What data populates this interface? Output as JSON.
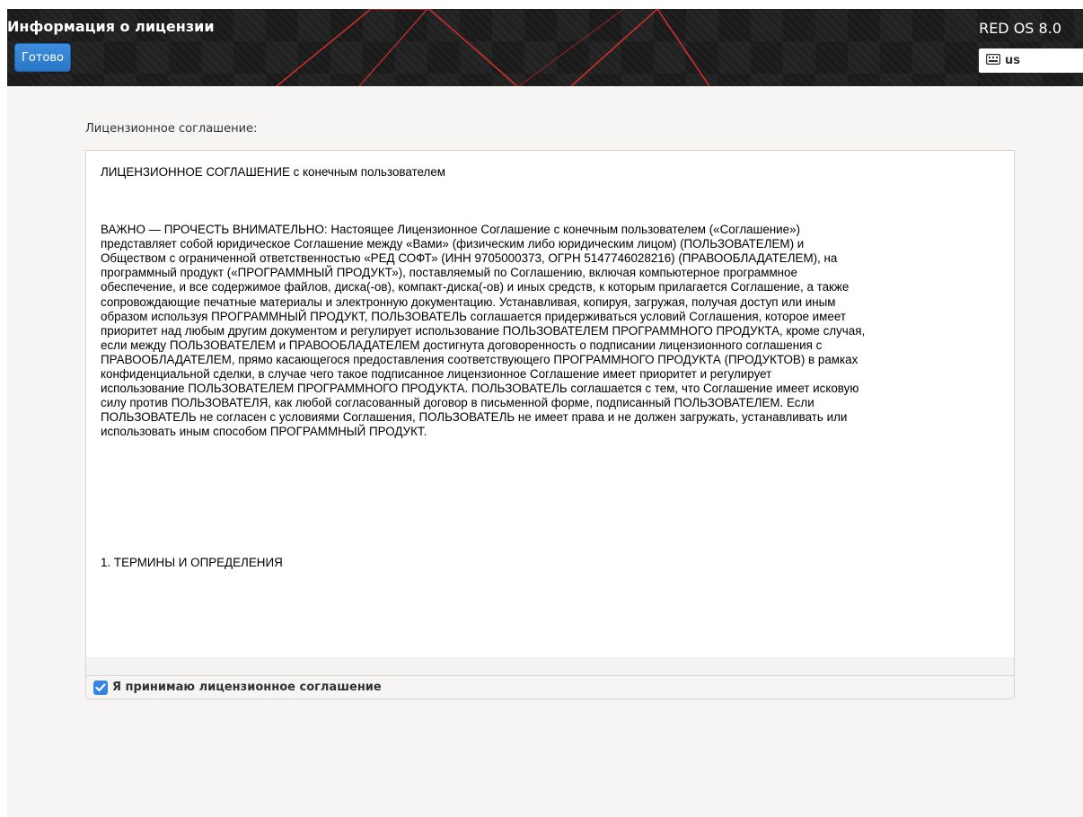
{
  "header": {
    "title": "Информация о лицензии",
    "done_label": "Готово",
    "os_name": "RED OS 8.0",
    "keyboard_layout": "us",
    "keyboard_icon": "keyboard-icon",
    "accent_color": "#3584e4"
  },
  "license": {
    "section_label": "Лицензионное соглашение:",
    "heading": "ЛИЦЕНЗИОННОЕ СОГЛАШЕНИЕ с конечным пользователем",
    "body": "ВАЖНО — ПРОЧЕСТЬ ВНИМАТЕЛЬНО: Настоящее Лицензионное Соглашение с конечным пользователем («Соглашение»)\nпредставляет собой юридическое Соглашение между «Вами» (физическим либо юридическим лицом) (ПОЛЬЗОВАТЕЛЕМ) и\nОбществом с ограниченной ответственностью «РЕД СОФТ» (ИНН 9705000373, ОГРН 5147746028216) (ПРАВООБЛАДАТЕЛЕМ), на\nпрограммный продукт («ПРОГРАММНЫЙ ПРОДУКТ»), поставляемый по Соглашению, включая компьютерное программное\nобеспечение, и все содержимое файлов, диска(-ов), компакт-диска(-ов) и иных средств, к которым прилагается Соглашение, а также\nсопровождающие печатные материалы и электронную документацию. Устанавливая, копируя, загружая, получая доступ или иным\nобразом используя ПРОГРАММНЫЙ ПРОДУКТ, ПОЛЬЗОВАТЕЛЬ соглашается придерживаться условий Соглашения, которое имеет\nприоритет над любым другим документом и регулирует использование ПОЛЬЗОВАТЕЛЕМ ПРОГРАММНОГО ПРОДУКТА, кроме случая,\nесли между ПОЛЬЗОВАТЕЛЕМ и ПРАВООБЛАДАТЕЛЕМ достигнута договоренность о подписании лицензионного соглашения с\nПРАВООБЛАДАТЕЛЕМ, прямо касающегося предоставления соответствующего ПРОГРАММНОГО ПРОДУКТА (ПРОДУКТОВ) в рамках\nконфиденциальной сделки, в случае чего такое подписанное лицензионное Соглашение имеет приоритет и регулирует\nиспользование ПОЛЬЗОВАТЕЛЕМ ПРОГРАММНОГО ПРОДУКТА. ПОЛЬЗОВАТЕЛЬ соглашается с тем, что Соглашение имеет исковую\nсилу против ПОЛЬЗОВАТЕЛЯ, как любой согласованный договор в письменной форме, подписанный ПОЛЬЗОВАТЕЛЕМ. Если\nПОЛЬЗОВАТЕЛЬ не согласен с условиями Соглашения, ПОЛЬЗОВАТЕЛЬ не имеет права и не должен загружать, устанавливать или\nиспользовать иным способом ПРОГРАММНЫЙ ПРОДУКТ.",
    "section_1": "1. ТЕРМИНЫ И ОПРЕДЕЛЕНИЯ"
  },
  "accept": {
    "label": "Я принимаю лицензионное соглашение",
    "checked": true,
    "check_icon": "checkmark-icon"
  }
}
